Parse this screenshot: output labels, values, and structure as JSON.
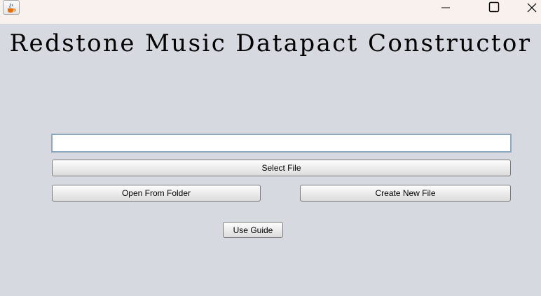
{
  "window": {
    "icon": "java-cup-icon",
    "controls": {
      "minimize": "minimize-icon",
      "maximize": "maximize-icon",
      "close": "close-icon"
    }
  },
  "main": {
    "title": "Redstone Music Datapact Constructor",
    "file_path": {
      "value": "",
      "placeholder": ""
    },
    "buttons": {
      "select_file": "Select File",
      "open_from_folder": "Open From Folder",
      "create_new_file": "Create New File",
      "use_guide": "Use Guide"
    }
  }
}
